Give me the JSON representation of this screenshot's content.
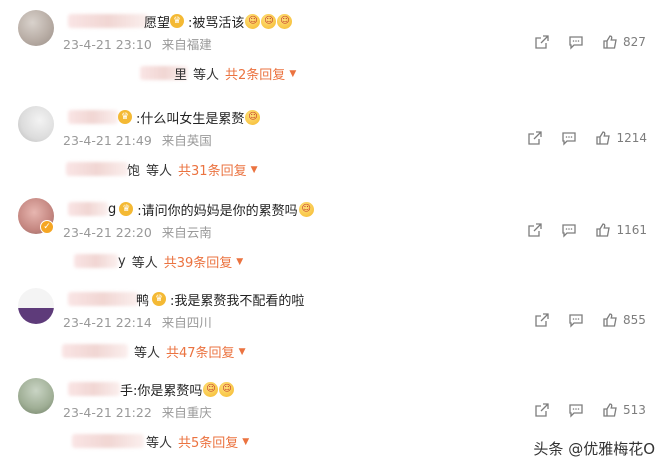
{
  "comments": [
    {
      "name_tail": "愿望",
      "text": ":被骂活该",
      "emojis": [
        "red-envelope-face",
        "red-envelope-face",
        "red-envelope-face"
      ],
      "date": "23-4-21 23:10",
      "location": "来自福建",
      "likes": "827",
      "reply_user_tail": "里",
      "reply_by": "等人",
      "reply_more": "共2条回复"
    },
    {
      "name_tail": "",
      "text": ":什么叫女生是累赘",
      "emojis": [
        "smile-face"
      ],
      "date": "23-4-21 21:49",
      "location": "来自英国",
      "likes": "1214",
      "reply_user_tail": "饱",
      "reply_by": "等人",
      "reply_more": "共31条回复"
    },
    {
      "name_tail": "g",
      "text": ":请问你的妈妈是你的累赘吗",
      "emojis": [
        "yawn-face"
      ],
      "date": "23-4-21 22:20",
      "location": "来自云南",
      "likes": "1161",
      "reply_user_tail": "y",
      "reply_by": "等人",
      "reply_more": "共39条回复"
    },
    {
      "name_tail": "鸭",
      "text": ":我是累赘我不配看的啦",
      "emojis": [],
      "date": "23-4-21 22:14",
      "location": "来自四川",
      "likes": "855",
      "reply_user_tail": "",
      "reply_by": "等人",
      "reply_more": "共47条回复"
    },
    {
      "name_tail": "手",
      "text": ":你是累赘吗",
      "emojis": [
        "laugh-face",
        "laugh-face"
      ],
      "date": "23-4-21 21:22",
      "location": "来自重庆",
      "likes": "513",
      "reply_user_tail": "",
      "reply_by": "等人",
      "reply_more": "共5条回复"
    }
  ],
  "watermark": "头条 @优雅梅花O"
}
